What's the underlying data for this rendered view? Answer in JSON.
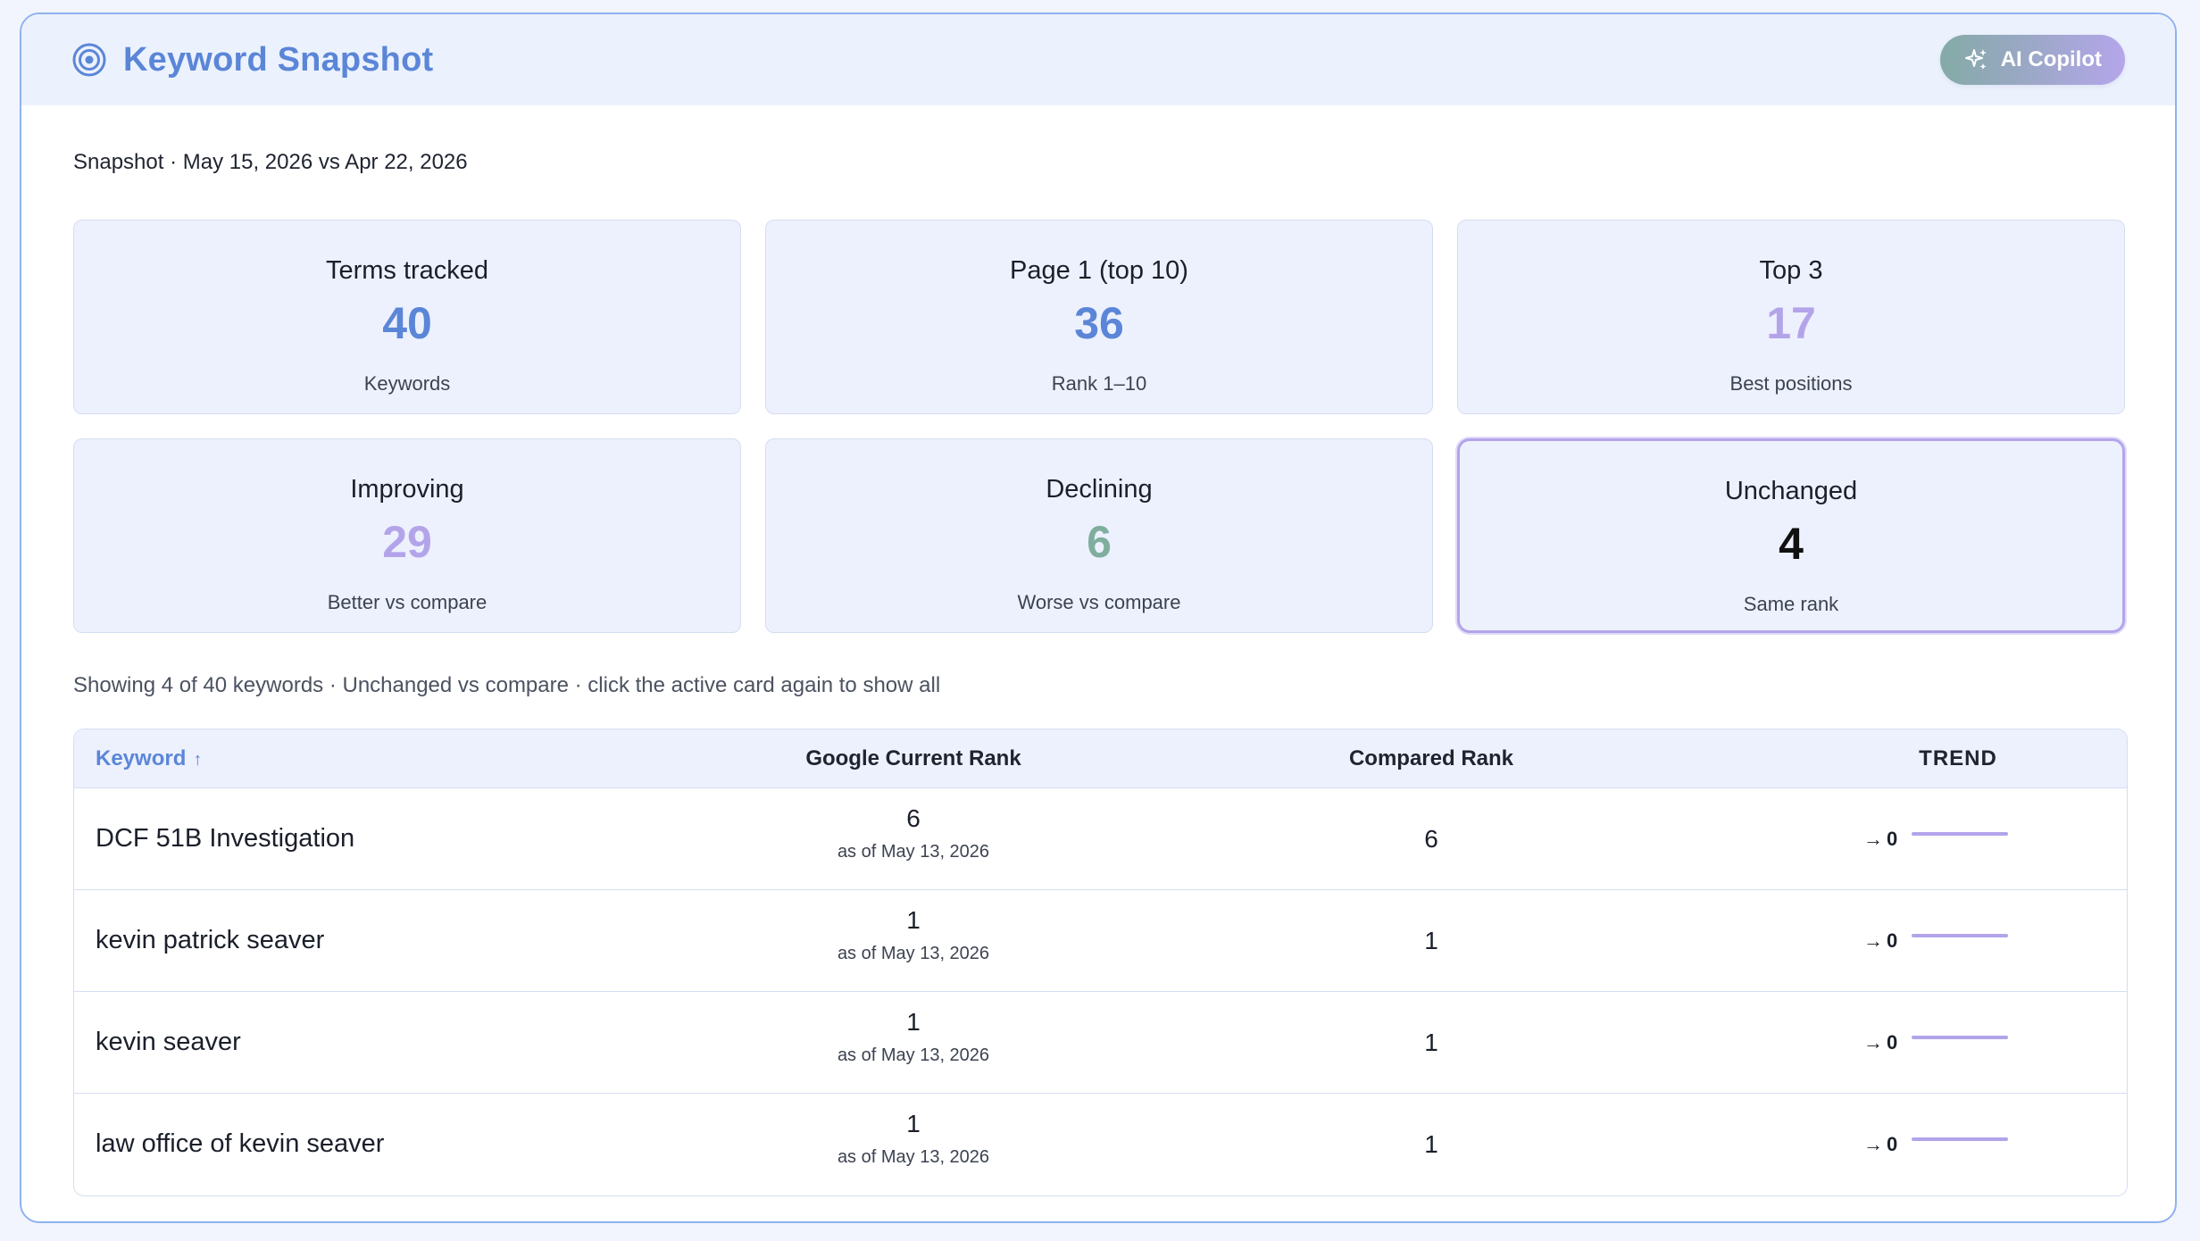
{
  "header": {
    "title": "Keyword Snapshot",
    "title_icon": "target-icon",
    "copilot_label": "AI Copilot",
    "copilot_icon": "sparkles-icon"
  },
  "snapshot_line": "Snapshot · May 15, 2026 vs Apr 22, 2026",
  "stats": [
    {
      "label": "Terms tracked",
      "value": "40",
      "sub": "Keywords",
      "color": "#5b86d8",
      "active": false
    },
    {
      "label": "Page 1 (top 10)",
      "value": "36",
      "sub": "Rank 1–10",
      "color": "#5b86d8",
      "active": false
    },
    {
      "label": "Top 3",
      "value": "17",
      "sub": "Best positions",
      "color": "#b3a4ea",
      "active": false
    },
    {
      "label": "Improving",
      "value": "29",
      "sub": "Better vs compare",
      "color": "#b3a4ea",
      "active": false
    },
    {
      "label": "Declining",
      "value": "6",
      "sub": "Worse vs compare",
      "color": "#7fae9e",
      "active": false
    },
    {
      "label": "Unchanged",
      "value": "4",
      "sub": "Same rank",
      "color": "#111111",
      "active": true
    }
  ],
  "showing_line": "Showing 4 of 40 keywords · Unchanged vs compare · click the active card again to show all",
  "table": {
    "headers": {
      "keyword": "Keyword",
      "keyword_sort_icon": "arrow-up-icon",
      "current": "Google Current Rank",
      "compared": "Compared Rank",
      "trend": "TREND"
    },
    "rows": [
      {
        "keyword": "DCF 51B Investigation",
        "current": "6",
        "as_of": "as of May 13, 2026",
        "compared": "6",
        "delta": "0"
      },
      {
        "keyword": "kevin patrick seaver",
        "current": "1",
        "as_of": "as of May 13, 2026",
        "compared": "1",
        "delta": "0"
      },
      {
        "keyword": "kevin seaver",
        "current": "1",
        "as_of": "as of May 13, 2026",
        "compared": "1",
        "delta": "0"
      },
      {
        "keyword": "law office of kevin seaver",
        "current": "1",
        "as_of": "as of May 13, 2026",
        "compared": "1",
        "delta": "0"
      }
    ],
    "trend_arrow": "→",
    "sparkline_color": "#b3a4ea"
  },
  "colors": {
    "accent_blue": "#5b86d8",
    "accent_lavender": "#b3a4ea",
    "accent_green": "#7fae9e"
  }
}
